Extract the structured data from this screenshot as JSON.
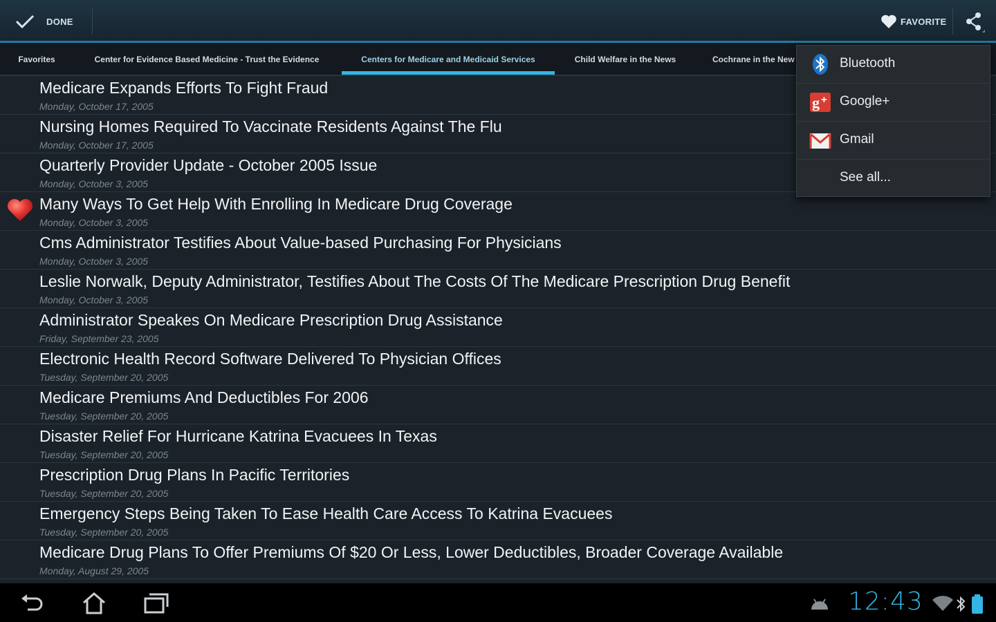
{
  "action_bar": {
    "done_label": "DONE",
    "favorite_label": "FAVORITE"
  },
  "tabs": [
    {
      "label": "Favorites",
      "active": false
    },
    {
      "label": "Center for Evidence Based Medicine - Trust the Evidence",
      "active": false
    },
    {
      "label": "Centers for Medicare and Medicaid Services",
      "active": true
    },
    {
      "label": "Child Welfare in the News",
      "active": false
    },
    {
      "label": "Cochrane in the New",
      "active": false
    }
  ],
  "articles": [
    {
      "title": "Medicare Expands Efforts To Fight Fraud",
      "date": "Monday, October 17, 2005",
      "favorite": false
    },
    {
      "title": "Nursing Homes Required To Vaccinate Residents Against The Flu",
      "date": "Monday, October 17, 2005",
      "favorite": false
    },
    {
      "title": "Quarterly Provider Update - October 2005 Issue",
      "date": "Monday, October 3, 2005",
      "favorite": false
    },
    {
      "title": "Many Ways To Get Help With Enrolling In Medicare Drug Coverage",
      "date": "Monday, October 3, 2005",
      "favorite": true
    },
    {
      "title": "Cms Administrator Testifies About Value-based Purchasing For Physicians",
      "date": "Monday, October 3, 2005",
      "favorite": false
    },
    {
      "title": "Leslie Norwalk, Deputy Administrator, Testifies About The Costs Of The Medicare Prescription Drug Benefit",
      "date": "Monday, October 3, 2005",
      "favorite": false
    },
    {
      "title": "Administrator Speakes On Medicare Prescription Drug Assistance",
      "date": "Friday, September 23, 2005",
      "favorite": false
    },
    {
      "title": "Electronic Health Record Software Delivered To Physician Offices",
      "date": "Tuesday, September 20, 2005",
      "favorite": false
    },
    {
      "title": "Medicare Premiums And Deductibles For 2006",
      "date": "Tuesday, September 20, 2005",
      "favorite": false
    },
    {
      "title": "Disaster Relief For Hurricane Katrina Evacuees In Texas",
      "date": "Tuesday, September 20, 2005",
      "favorite": false
    },
    {
      "title": "Prescription Drug Plans In Pacific Territories",
      "date": "Tuesday, September 20, 2005",
      "favorite": false
    },
    {
      "title": "Emergency Steps Being Taken To Ease Health Care Access To Katrina Evacuees",
      "date": "Tuesday, September 20, 2005",
      "favorite": false
    },
    {
      "title": "Medicare Drug Plans To Offer Premiums Of $20 Or Less, Lower Deductibles, Broader Coverage Available",
      "date": "Monday, August 29, 2005",
      "favorite": false
    }
  ],
  "share_menu": [
    {
      "label": "Bluetooth",
      "icon": "bluetooth-icon"
    },
    {
      "label": "Google+",
      "icon": "google-plus-icon"
    },
    {
      "label": "Gmail",
      "icon": "gmail-icon"
    },
    {
      "label": "See all...",
      "icon": ""
    }
  ],
  "system_bar": {
    "time": "12:43"
  },
  "colors": {
    "accent": "#33b5e5",
    "heart": "#e53935",
    "background": "#1b2229"
  }
}
